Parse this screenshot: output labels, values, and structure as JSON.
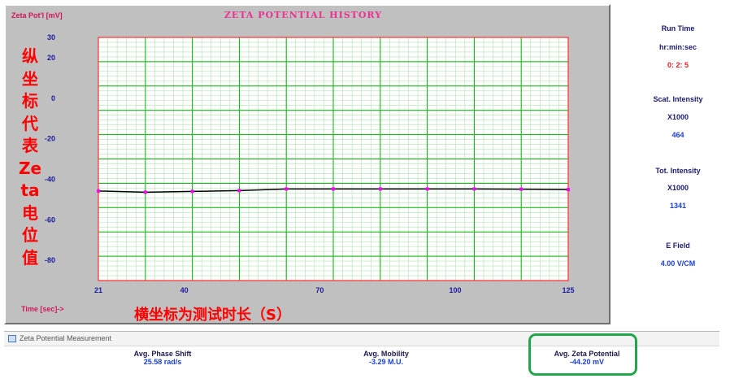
{
  "chart": {
    "title": "ZETA POTENTIAL HISTORY",
    "y_axis_label": "Zeta Pot'l [mV]",
    "x_axis_label": "Time [sec]->"
  },
  "annotations": {
    "y_axis_note": [
      "纵",
      "坐",
      "标",
      "代",
      "表",
      "Ze",
      "ta",
      "电",
      "位",
      "值"
    ],
    "x_axis_note": "横坐标为测试时长（S）"
  },
  "side_panel": {
    "run_time_label": "Run Time",
    "run_time_unit": "hr:min:sec",
    "run_time_value": "0: 2: 5",
    "scat_label": "Scat. Intensity",
    "scat_unit": "X1000",
    "scat_value": "464",
    "tot_label": "Tot. Intensity",
    "tot_unit": "X1000",
    "tot_value": "1341",
    "efield_label": "E Field",
    "efield_value": "4.00 V/CM"
  },
  "measurement_window": {
    "title": "Zeta Potential Measurement",
    "phase_shift_label": "Avg. Phase Shift",
    "phase_shift_value": "25.58 rad/s",
    "mobility_label": "Avg. Mobility",
    "mobility_value": "-3.29 M.U.",
    "zeta_label": "Avg. Zeta Potential",
    "zeta_value": "-44.20 mV"
  },
  "colors": {
    "plot_background": "#ffffff",
    "grid_major": "#00b400",
    "grid_minor": "#b0e0b0",
    "frame": "#ff3030",
    "line": "#000000",
    "markers": "#ff00ff",
    "highlight": "#22a64a"
  },
  "chart_data": {
    "type": "line",
    "title": "ZETA POTENTIAL HISTORY",
    "xlabel": "Time [sec]->",
    "ylabel": "Zeta Pot'l [mV]",
    "xlim": [
      21,
      125
    ],
    "ylim": [
      -90,
      30
    ],
    "xticks": [
      21,
      40,
      70,
      100,
      125
    ],
    "yticks": [
      30,
      20,
      0,
      -20,
      -40,
      -60,
      -80
    ],
    "grid": true,
    "series": [
      {
        "x": [
          21,
          31.4,
          41.8,
          52.2,
          62.6,
          73,
          83.4,
          93.8,
          104.2,
          114.6,
          125
        ],
        "values": [
          -45.8,
          -46.4,
          -46.0,
          -45.6,
          -44.8,
          -44.8,
          -44.8,
          -44.8,
          -44.8,
          -44.9,
          -45.1
        ]
      }
    ]
  }
}
